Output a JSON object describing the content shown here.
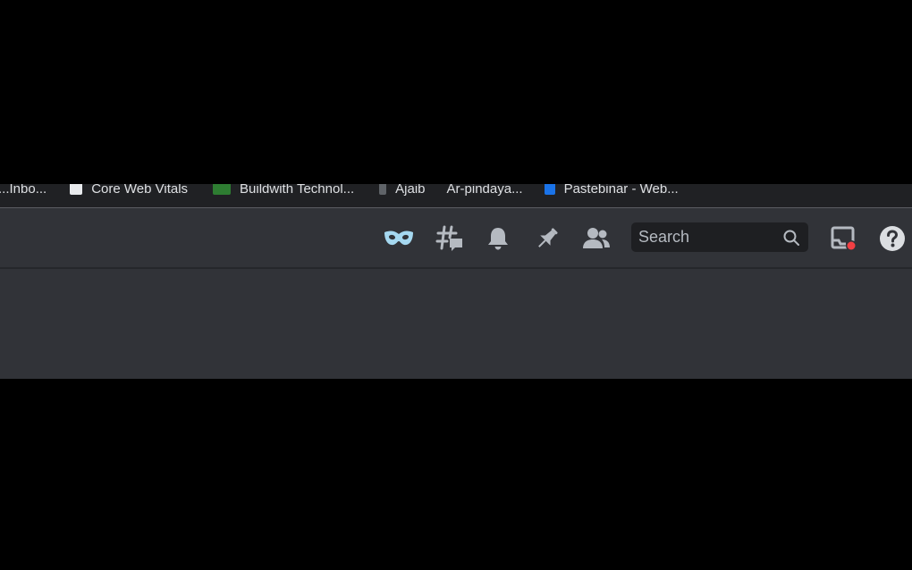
{
  "bookmarks": [
    {
      "label": "...Inbo...",
      "color": "#5f6368"
    },
    {
      "label": "Core Web Vitals",
      "color": "#e8eaed"
    },
    {
      "label": "Buildwith Technol...",
      "color": "#2e7d32"
    },
    {
      "label": "Ajaib",
      "color": "#5f6368"
    },
    {
      "label": "Ar-pindaya...",
      "color": "#9aa0a6"
    },
    {
      "label": "Pastebinar - Web...",
      "color": "#1a73e8"
    }
  ],
  "header": {
    "icons": [
      {
        "name": "quest-mask-icon",
        "color": "#a5d8f0"
      },
      {
        "name": "threads-icon",
        "color": "#b5bac1"
      },
      {
        "name": "notification-bell-icon",
        "color": "#b5bac1"
      },
      {
        "name": "pin-icon",
        "color": "#b5bac1"
      },
      {
        "name": "member-list-icon",
        "color": "#b5bac1"
      }
    ],
    "search": {
      "placeholder": "Search"
    },
    "inbox_badge_color": "#f23f43",
    "help_icon": "help-icon"
  },
  "colors": {
    "app_bg": "#313338",
    "search_bg": "#1e1f22",
    "icon_default": "#b5bac1"
  }
}
